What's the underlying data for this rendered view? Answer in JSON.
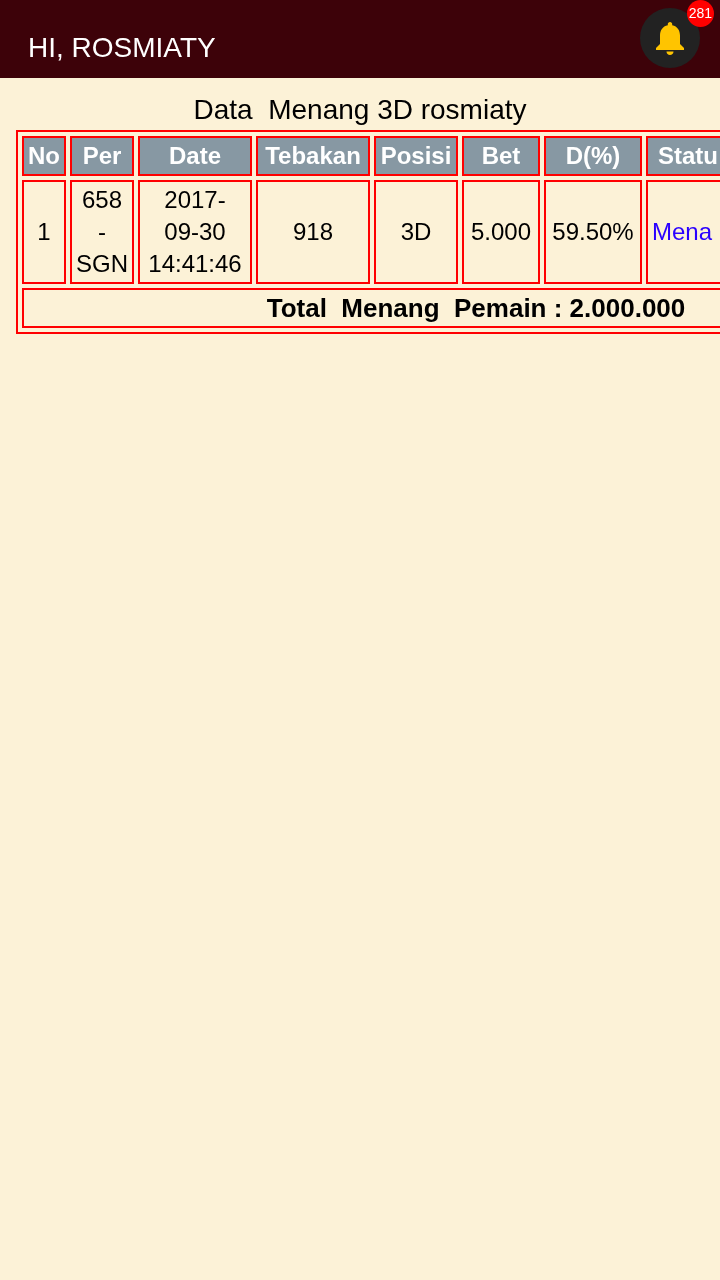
{
  "header": {
    "greeting": "HI, ROSMIATY",
    "notifications": {
      "count": "281"
    }
  },
  "title": "Data  Menang 3D rosmiaty",
  "table": {
    "columns": [
      {
        "label": "No",
        "kind": "text"
      },
      {
        "label": "Per",
        "kind": "text"
      },
      {
        "label": "Date",
        "kind": "text"
      },
      {
        "label": "Tebakan",
        "kind": "text"
      },
      {
        "label": "Posisi",
        "kind": "text"
      },
      {
        "label": "Bet",
        "kind": "text"
      },
      {
        "label": "D(%)",
        "kind": "text"
      },
      {
        "label": "Statu",
        "kind": "link"
      }
    ],
    "rows": [
      [
        "1",
        "658\n-\nSGN",
        "2017-\n09-30\n14:41:46",
        "918",
        "3D",
        "5.000",
        "59.50%",
        "Mena"
      ]
    ],
    "total": "Total  Menang  Pemain : 2.000.000"
  }
}
